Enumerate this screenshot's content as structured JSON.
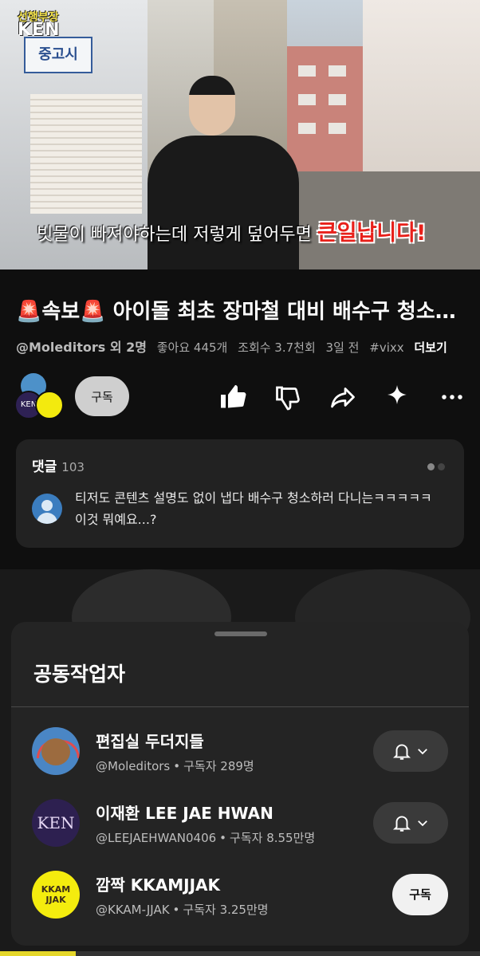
{
  "video": {
    "channel_logo_line1": "선행부장",
    "channel_logo_line2": "KEN",
    "caption_normal": "빗물이 빠져야하는데 저렇게 덮어두면 ",
    "caption_emphasis": "큰일납니다!",
    "store_sign": "중고시"
  },
  "details": {
    "title": "🚨속보🚨 아이돌 최초 장마철 대비 배수구 청소 대작전",
    "channel": "@Moleditors 외 2명",
    "likes": "좋아요 445개",
    "views": "조회수 3.7천회",
    "age": "3일 전",
    "hashtag": "#vixx",
    "more": "더보기",
    "subscribe_label": "구독",
    "avatar_b_text": "KEN",
    "actions": [
      "like-icon",
      "dislike-icon",
      "share-icon",
      "sparkle-icon",
      "more-icon"
    ]
  },
  "comments": {
    "heading": "댓글",
    "count": "103",
    "top_comment": "티저도 콘텐츠 설명도 없이 냅다 배수구 청소하러 다니는ㅋㅋㅋㅋㅋ 이것 뭐예요...?"
  },
  "collaborators": {
    "title": "공동작업자",
    "items": [
      {
        "name": "편집실 두더지들",
        "handle": "@Moleditors",
        "subs": "구독자 289명",
        "action": "bell"
      },
      {
        "name": "이재환 LEE JAE HWAN",
        "handle": "@LEEJAEHWAN0406",
        "subs": "구독자 8.55만명",
        "action": "bell",
        "avatar_text": "KEN"
      },
      {
        "name": "깜짝 KKAMJJAK",
        "handle": "@KKAM-JJAK",
        "subs": "구독자 3.25만명",
        "action": "subscribe",
        "subscribe_label": "구독",
        "avatar_text": "KKAM JJAK"
      }
    ],
    "separator": "•"
  },
  "colors": {
    "accent": "#e5d72a",
    "caption_red": "#e8201a",
    "sheet_bg": "#242424"
  }
}
